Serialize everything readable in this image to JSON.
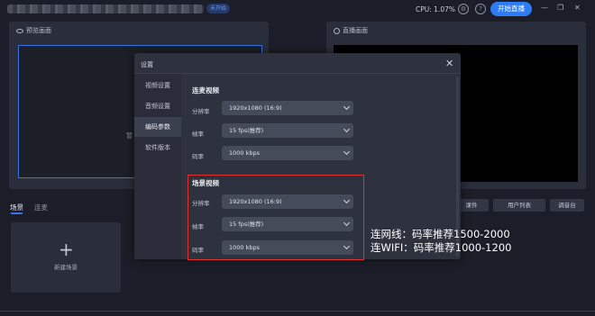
{
  "topbar": {
    "status_badge": "未开始",
    "cpu": "CPU: 1.07%",
    "help_icon_glyph": "?",
    "start_live_label": "开始直播",
    "minimize_glyph": "—",
    "maximize_glyph": "❐",
    "close_glyph": "✕",
    "accent_color": "#2c7cf6"
  },
  "preview_panel": {
    "title": "预览画面",
    "partial_text": "暂"
  },
  "live_panel": {
    "title": "直播画面"
  },
  "scenes": {
    "tabs": [
      "场景",
      "连麦"
    ],
    "new_scene_label": "新建场景",
    "plus_glyph": "+"
  },
  "right_buttons": [
    "课件",
    "用户列表",
    "调音台"
  ],
  "settings_dialog": {
    "title": "设置",
    "close_glyph": "✕",
    "nav": [
      "视频设置",
      "音频设置",
      "编码参数",
      "软件版本"
    ],
    "active_nav": 2,
    "mic_video": {
      "title": "连麦视频",
      "fields": [
        {
          "label": "分辨率",
          "value": "1920x1080 (16:9)"
        },
        {
          "label": "帧率",
          "value": "15 fps(推荐)"
        },
        {
          "label": "码率",
          "value": "1000 kbps"
        }
      ]
    },
    "scene_video": {
      "title": "场景视频",
      "fields": [
        {
          "label": "分辨率",
          "value": "1920x1080 (16:9)"
        },
        {
          "label": "帧率",
          "value": "15 fps(推荐)"
        },
        {
          "label": "码率",
          "value": "1000 kbps"
        }
      ]
    }
  },
  "annotation": {
    "line1": "连网线：码率推荐1500-2000",
    "line2": "连WIFI：码率推荐1000-1200",
    "highlight_color": "#e0312f"
  }
}
